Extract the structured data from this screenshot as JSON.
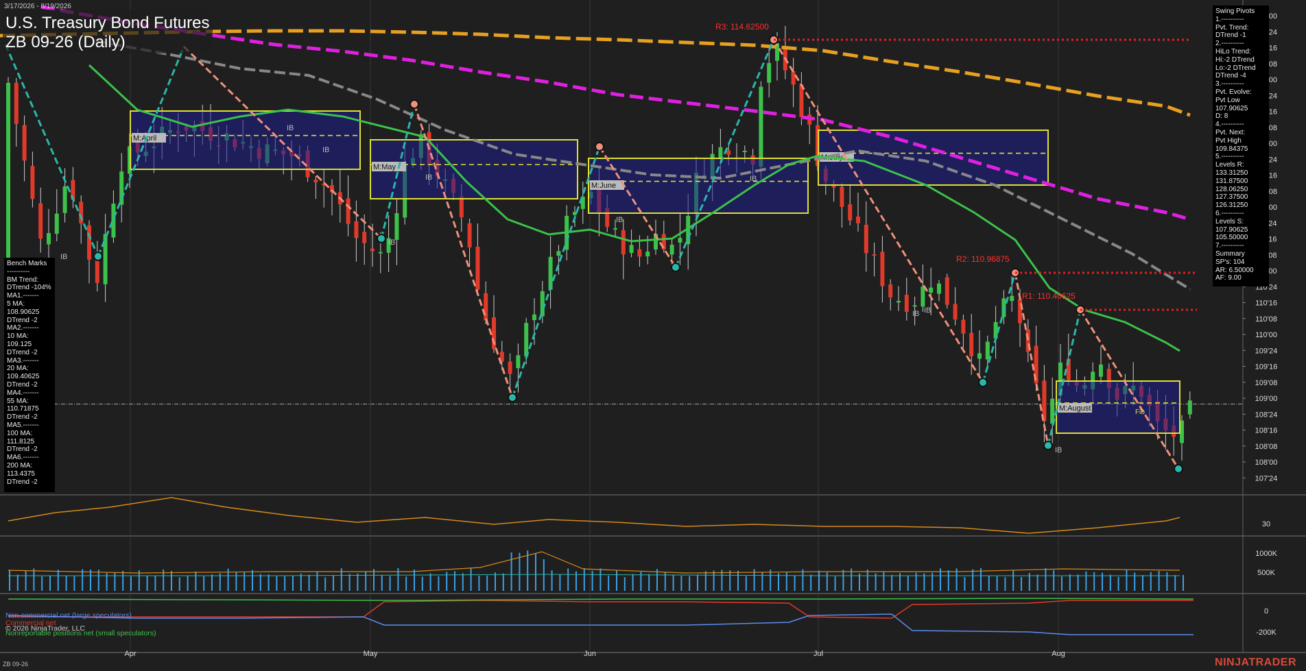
{
  "header": {
    "date_range": "3/17/2026 - 8/19/2026",
    "title": "U.S. Treasury Bond Futures",
    "subtitle": "ZB 09-26 (Daily)"
  },
  "brand": "NINJATRADER",
  "footer_symbol": "ZB 09-26",
  "copyright": "© 2026 NinjaTrader, LLC",
  "swing_pivots_panel": [
    "Swing Pivots",
    "1.----------",
    "Pvt. Trend:",
    "DTrend -1",
    "2.----------",
    "HiLo Trend:",
    "Hi:-2 DTrend",
    "Lo:-2 DTrend",
    "DTrend -4",
    "3.----------",
    "Pvt. Evolve:",
    "Pvt Low",
    "107.90625",
    "D: 8",
    "4.----------",
    "Pvt. Next:",
    "Pvt High",
    "109.84375",
    "5.----------",
    "Levels R:",
    "133.31250",
    "131.87500",
    "128.06250",
    "127.37500",
    "126.31250",
    "6.----------",
    "Levels S:",
    "107.90625",
    "105.50000",
    "7.----------",
    "Summary",
    "SP's: 104",
    "AR: 6.50000",
    "AF: 9.00"
  ],
  "benchmarks_panel": [
    "Bench Marks",
    "----------",
    "BM Trend:",
    "DTrend -104%",
    "MA1.-------",
    "5 MA:",
    "108.90625",
    "DTrend -2",
    "MA2.-------",
    "10 MA:",
    "109.125",
    "DTrend -2",
    "MA3.-------",
    "20 MA:",
    "109.40625",
    "DTrend -2",
    "MA4.-------",
    "55 MA:",
    "110.71875",
    "DTrend -2",
    "MA5.-------",
    "100 MA:",
    "111.8125",
    "DTrend -2",
    "MA6.-------",
    "200 MA:",
    "113.4375",
    "DTrend -2"
  ],
  "resistance_labels": [
    {
      "text": "R3: 114.62500",
      "value": 114.625
    },
    {
      "text": "R2: 110.96875",
      "value": 110.96875
    },
    {
      "text": "R1: 110.40625",
      "value": 110.40625
    }
  ],
  "month_boxes": [
    "M:April",
    "M:May",
    "M:June",
    "M:July",
    "M:August"
  ],
  "ib_label": "IB",
  "fib_label": "Fib",
  "legends": [
    {
      "text": "Non-commercial net (large speculators)",
      "color": "#5b8cf0"
    },
    {
      "text": "Commercial net",
      "color": "#e03a2a"
    },
    {
      "text": "Nonreportable positions net (small speculators)",
      "color": "#3cc24a"
    }
  ],
  "chart_data": {
    "type": "candlestick",
    "x_labels": [
      "Apr",
      "May",
      "Jun",
      "Jul",
      "Aug"
    ],
    "y_ticks_price": [
      "115'00",
      "114'24",
      "114'16",
      "114'08",
      "114'00",
      "113'24",
      "113'16",
      "113'08",
      "113'00",
      "112'24",
      "112'16",
      "112'08",
      "112'00",
      "111'24",
      "111'16",
      "111'08",
      "111'00",
      "110'24",
      "110'16",
      "110'08",
      "110'00",
      "109'24",
      "109'16",
      "109'08",
      "109'00",
      "108'24",
      "108'16",
      "108'08",
      "108'00",
      "107'24"
    ],
    "y_ticks_adx": [
      "30"
    ],
    "y_ticks_volume": [
      "1000K",
      "500K"
    ],
    "y_ticks_cot": [
      "0",
      "-200K"
    ],
    "ylim_price": [
      107.6,
      115.15
    ],
    "moving_average_colors": {
      "fast": "#3cc24a",
      "mid": "#888888",
      "slow_magenta": "#e020e0",
      "slow_orange": "#e8a020"
    },
    "swing_lines_colors": {
      "up": "#2ab7a9",
      "down": "#f0907a"
    },
    "candle_colors": {
      "up": "#3cc24a",
      "down": "#e03a2a"
    },
    "last_price": 108.90625,
    "pivot_low": 107.90625,
    "pivot_high_next": 109.84375
  }
}
